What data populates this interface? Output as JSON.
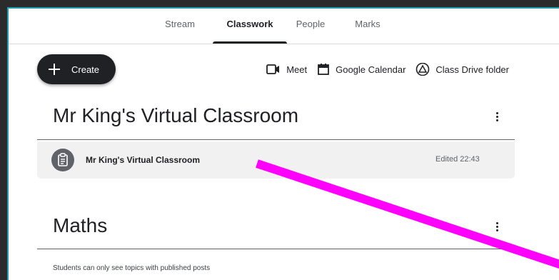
{
  "tabs": [
    {
      "label": "Stream",
      "active": false
    },
    {
      "label": "Classwork",
      "active": true
    },
    {
      "label": "People",
      "active": false
    },
    {
      "label": "Marks",
      "active": false
    }
  ],
  "toolbar": {
    "create_label": "Create",
    "links": [
      {
        "label": "Meet",
        "icon": "video-camera-icon"
      },
      {
        "label": "Google Calendar",
        "icon": "calendar-icon"
      },
      {
        "label": "Class Drive folder",
        "icon": "drive-icon"
      }
    ]
  },
  "topics": [
    {
      "title": "Mr King's Virtual Classroom",
      "items": [
        {
          "title": "Mr King's Virtual Classroom",
          "edited": "Edited 22:43",
          "icon": "assignment-icon"
        }
      ]
    },
    {
      "title": "Maths",
      "note": "Students can only see topics with published posts"
    }
  ],
  "colors": {
    "accent": "#202124",
    "frame_border": "#1e9db0",
    "annotation": "#ff00ff"
  }
}
